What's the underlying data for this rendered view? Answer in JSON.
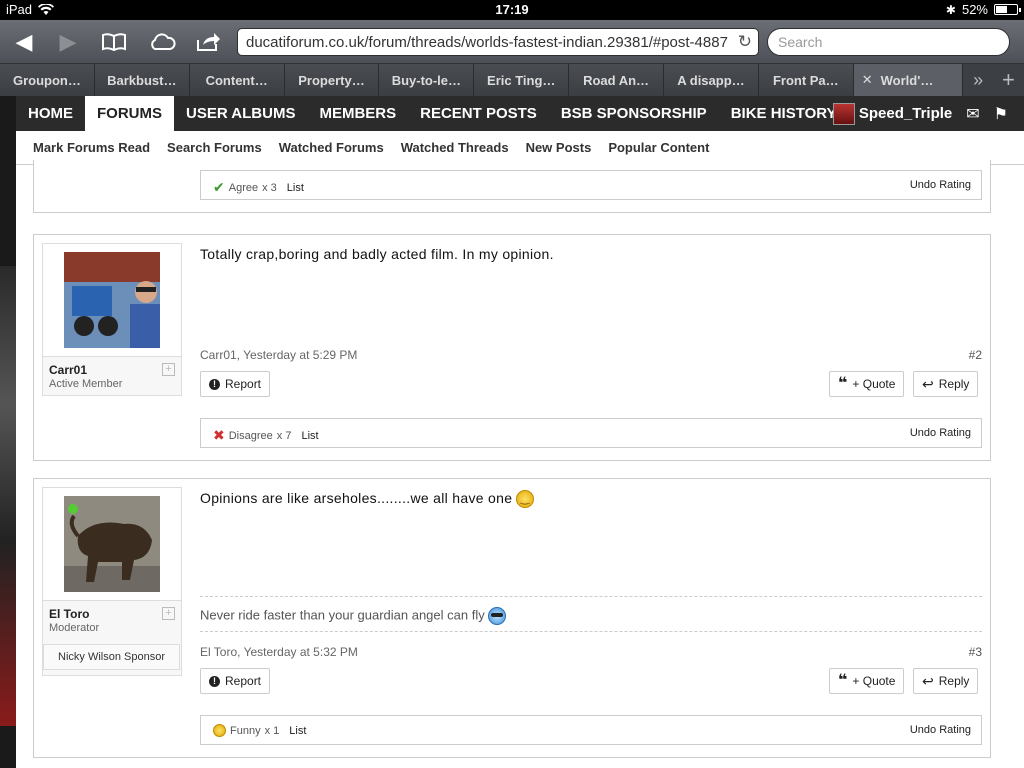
{
  "status_bar": {
    "device": "iPad",
    "time": "17:19",
    "battery": "52%",
    "battery_level": 0.52
  },
  "browser": {
    "url": "ducatiforum.co.uk/forum/threads/worlds-fastest-indian.29381/#post-4887",
    "search_placeholder": "Search",
    "tabs": [
      {
        "label": "Groupon…"
      },
      {
        "label": "Barkbust…"
      },
      {
        "label": "Content…"
      },
      {
        "label": "Property…"
      },
      {
        "label": "Buy-to-le…"
      },
      {
        "label": "Eric Ting…"
      },
      {
        "label": "Road An…"
      },
      {
        "label": "A disapp…"
      },
      {
        "label": "Front Pa…"
      },
      {
        "label": "World'…"
      }
    ]
  },
  "site_nav": {
    "items": [
      "HOME",
      "FORUMS",
      "USER ALBUMS",
      "MEMBERS",
      "RECENT POSTS",
      "BSB SPONSORSHIP",
      "BIKE HISTORY"
    ],
    "active": "FORUMS",
    "username": "Speed_Triple"
  },
  "sub_nav": [
    "Mark Forums Read",
    "Search Forums",
    "Watched Forums",
    "Watched Threads",
    "New Posts",
    "Popular Content"
  ],
  "posts": [
    {
      "rating": {
        "label": "Agree",
        "count": "x 3",
        "list": "List",
        "undo": "Undo Rating"
      }
    },
    {
      "username": "Carr01",
      "user_title": "Active Member",
      "text": "Totally crap,boring and badly acted film. In my opinion.",
      "meta": "Carr01, Yesterday at 5:29 PM",
      "number": "#2",
      "report": "Report",
      "quote": "+ Quote",
      "reply": "Reply",
      "rating": {
        "label": "Disagree",
        "count": "x 7",
        "list": "List",
        "undo": "Undo Rating"
      }
    },
    {
      "username": "El Toro",
      "user_title": "Moderator",
      "sponsor": "Nicky Wilson Sponsor",
      "text": "Opinions are like arseholes........we all have one",
      "signature": "Never ride faster than your guardian angel can fly",
      "meta": "El Toro, Yesterday at 5:32 PM",
      "number": "#3",
      "report": "Report",
      "quote": "+ Quote",
      "reply": "Reply",
      "rating": {
        "label": "Funny",
        "count": "x 1",
        "list": "List",
        "undo": "Undo Rating"
      }
    }
  ]
}
